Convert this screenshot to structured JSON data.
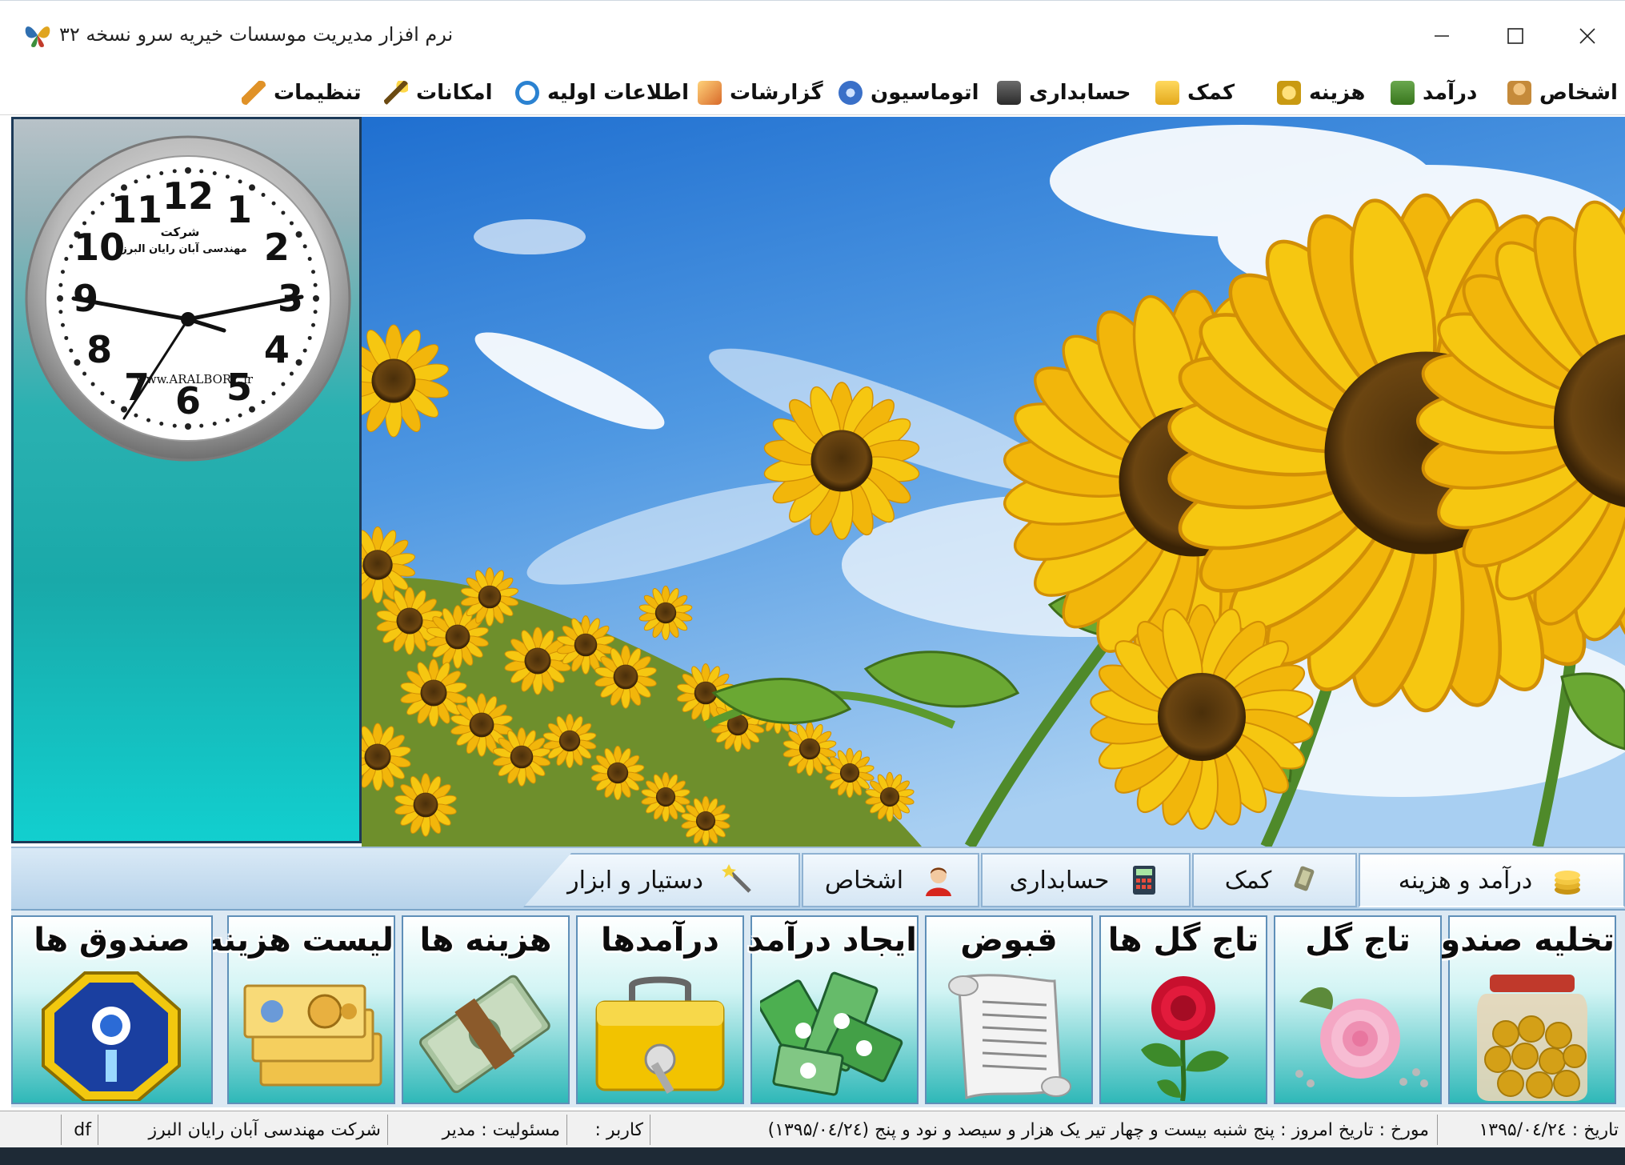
{
  "window": {
    "title": "نرم افزار مدیریت موسسات خیریه سرو نسخه ۳۲",
    "controls": {
      "minimize": "—",
      "maximize": "☐",
      "close": "✕"
    }
  },
  "menu": [
    {
      "label": "اشخاص",
      "icon": "people-icon",
      "color": "#c58a3a"
    },
    {
      "label": "درآمد",
      "icon": "money-stack-icon",
      "color": "#4e8a3a"
    },
    {
      "label": "هزینه",
      "icon": "coins-icon",
      "color": "#d4a81e"
    },
    {
      "label": "کمک",
      "icon": "hand-coins-icon",
      "color": "#e3b92c"
    },
    {
      "label": "حسابداری",
      "icon": "calculator-icon",
      "color": "#3d3d3d"
    },
    {
      "label": "اتوماسیون",
      "icon": "gear-globe-icon",
      "color": "#3a70c8"
    },
    {
      "label": "گزارشات",
      "icon": "report-icon",
      "color": "#d86a2a"
    },
    {
      "label": "اطلاعات اولیه",
      "icon": "refresh-icon",
      "color": "#2b82d1"
    },
    {
      "label": "امکانات",
      "icon": "wand-icon",
      "color": "#c9a020"
    },
    {
      "label": "تنظیمات",
      "icon": "wrench-icon",
      "color": "#e09228"
    }
  ],
  "clock": {
    "company_line1": "شرکت",
    "company_line2": "مهندسی آبان رایان البرز",
    "website": "www.ARALBORZ.ir",
    "numerals": [
      "12",
      "1",
      "2",
      "3",
      "4",
      "5",
      "6",
      "7",
      "8",
      "9",
      "10",
      "11"
    ]
  },
  "tabs": [
    {
      "label": "درآمد و هزینه",
      "icon": "coins-icon",
      "active": true
    },
    {
      "label": "کمک",
      "icon": "hand-money-icon",
      "active": false
    },
    {
      "label": "حسابداری",
      "icon": "calculator-icon",
      "active": false
    },
    {
      "label": "اشخاص",
      "icon": "person-icon",
      "active": false
    },
    {
      "label": "دستیار و ابزار",
      "icon": "magic-wand-icon",
      "active": false
    }
  ],
  "tiles": [
    {
      "label": "تخلیه صندوق",
      "icon": "coin-jar-icon"
    },
    {
      "label": "تاج گل",
      "icon": "pink-rose-icon"
    },
    {
      "label": "تاج گل ها",
      "icon": "red-rose-icon"
    },
    {
      "label": "قبوض",
      "icon": "scroll-receipt-icon"
    },
    {
      "label": "ایجاد درآمد",
      "icon": "banknotes-icon"
    },
    {
      "label": "درآمدها",
      "icon": "cash-box-icon"
    },
    {
      "label": "هزینه ها",
      "icon": "dollar-bundle-icon"
    },
    {
      "label": "لیست هزینه",
      "icon": "cheques-icon"
    },
    {
      "label": "صندوق ها",
      "icon": "charity-box-icon"
    }
  ],
  "status": {
    "date": "تاریخ : ۱۳۹۵/۰٤/۲٤",
    "dated": "مورخ : تاریخ امروز : پنج شنبه بیست و چهار تیر یک هزار و سیصد و نود و پنج (۱۳۹۵/۰٤/۲٤)",
    "user": "کاربر :",
    "responsibility": "مسئولیت : مدیر",
    "company": "شرکت مهندسی آبان رایان البرز",
    "extra": "df"
  }
}
